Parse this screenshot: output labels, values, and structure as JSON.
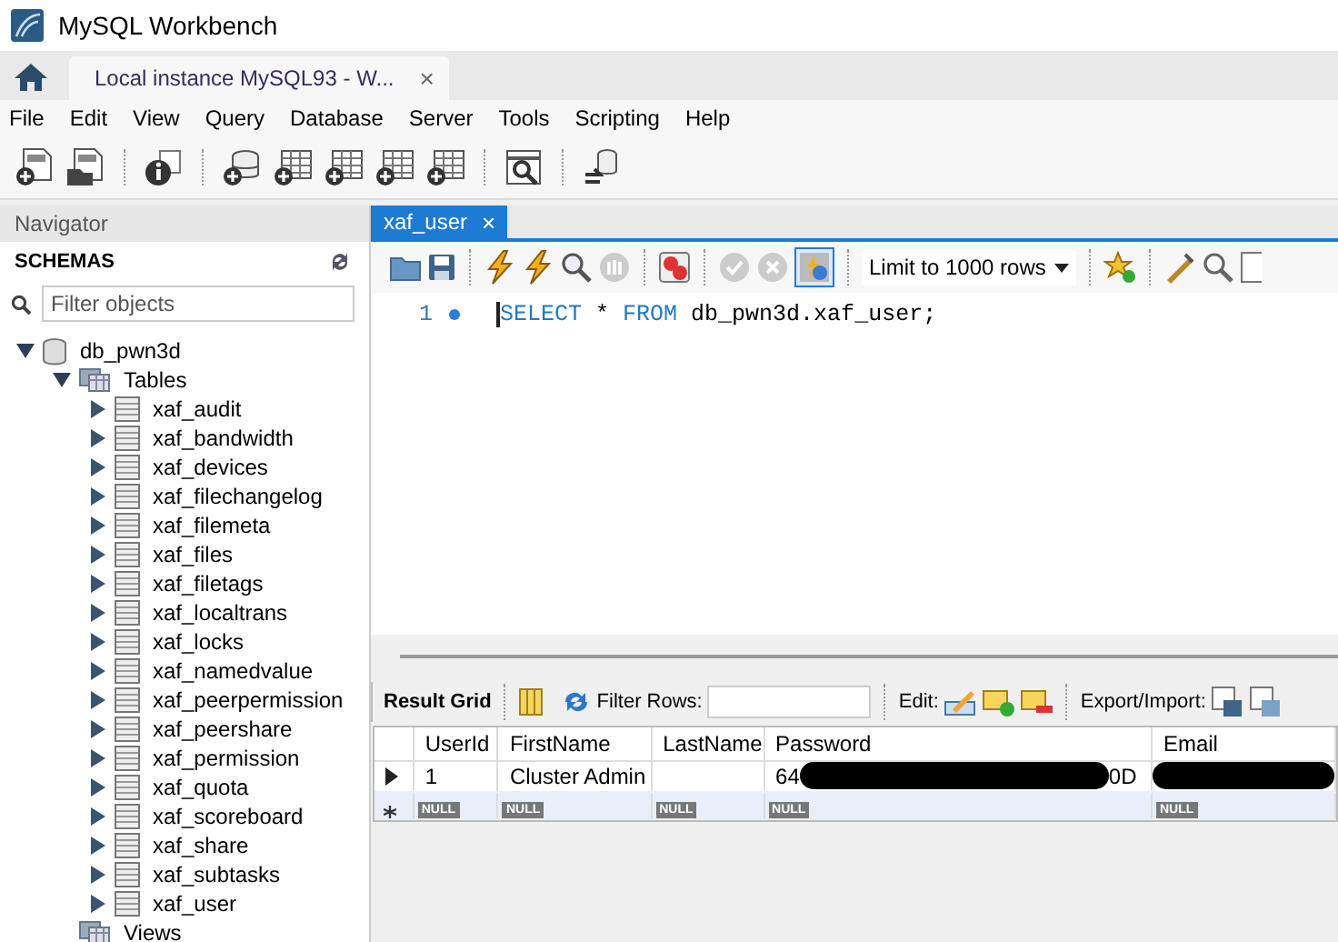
{
  "window": {
    "title": "MySQL Workbench"
  },
  "connection_tab": {
    "label": "Local instance MySQL93 - W...",
    "close": "×",
    "selected": true
  },
  "menu": [
    "File",
    "Edit",
    "View",
    "Query",
    "Database",
    "Server",
    "Tools",
    "Scripting",
    "Help"
  ],
  "navigator": {
    "title": "Navigator",
    "section": "SCHEMAS",
    "filter": {
      "placeholder": "Filter objects"
    },
    "tree": [
      {
        "label": "db_pwn3d",
        "kind": "schema",
        "expanded": true,
        "children": [
          {
            "label": "Tables",
            "kind": "folder",
            "expanded": true,
            "children": [
              {
                "label": "xaf_audit",
                "kind": "table",
                "expanded": false
              },
              {
                "label": "xaf_bandwidth",
                "kind": "table",
                "expanded": false
              },
              {
                "label": "xaf_devices",
                "kind": "table",
                "expanded": false
              },
              {
                "label": "xaf_filechangelog",
                "kind": "table",
                "expanded": false
              },
              {
                "label": "xaf_filemeta",
                "kind": "table",
                "expanded": false
              },
              {
                "label": "xaf_files",
                "kind": "table",
                "expanded": false
              },
              {
                "label": "xaf_filetags",
                "kind": "table",
                "expanded": false
              },
              {
                "label": "xaf_localtrans",
                "kind": "table",
                "expanded": false
              },
              {
                "label": "xaf_locks",
                "kind": "table",
                "expanded": false
              },
              {
                "label": "xaf_namedvalue",
                "kind": "table",
                "expanded": false
              },
              {
                "label": "xaf_peerpermission",
                "kind": "table",
                "expanded": false
              },
              {
                "label": "xaf_peershare",
                "kind": "table",
                "expanded": false
              },
              {
                "label": "xaf_permission",
                "kind": "table",
                "expanded": false
              },
              {
                "label": "xaf_quota",
                "kind": "table",
                "expanded": false
              },
              {
                "label": "xaf_scoreboard",
                "kind": "table",
                "expanded": false
              },
              {
                "label": "xaf_share",
                "kind": "table",
                "expanded": false
              },
              {
                "label": "xaf_subtasks",
                "kind": "table",
                "expanded": false
              },
              {
                "label": "xaf_user",
                "kind": "table",
                "expanded": false
              }
            ]
          },
          {
            "label": "Views",
            "kind": "folder"
          }
        ]
      }
    ]
  },
  "editor_tab": {
    "label": "xaf_user",
    "close": "×",
    "selected": true
  },
  "editor_toolbar": {
    "limit": "Limit to 1000 rows",
    "autocommit": true
  },
  "editor": {
    "lines": [
      {
        "number": "1",
        "tokens": [
          {
            "kind": "keyword",
            "text": "SELECT"
          },
          {
            "kind": "plain",
            "text": " * "
          },
          {
            "kind": "keyword",
            "text": "FROM"
          },
          {
            "kind": "plain",
            "text": " db_pwn3d.xaf_user;"
          }
        ]
      }
    ]
  },
  "result": {
    "view": "Result Grid",
    "filter_label": "Filter Rows:",
    "edit_label": "Edit:",
    "export_label": "Export/Import:",
    "columns": [
      "UserId",
      "FirstName",
      "LastName",
      "Password",
      "Email"
    ],
    "rows": [
      {
        "current": true,
        "cells": [
          {
            "kind": "text",
            "text": "1"
          },
          {
            "kind": "text",
            "text": "Cluster Admin"
          },
          {
            "kind": "empty"
          },
          {
            "kind": "redacted",
            "before": "64",
            "after": "0D"
          },
          {
            "kind": "redacted"
          }
        ]
      }
    ],
    "new_row": [
      "NULL",
      "NULL",
      "NULL",
      "NULL",
      "NULL"
    ]
  }
}
